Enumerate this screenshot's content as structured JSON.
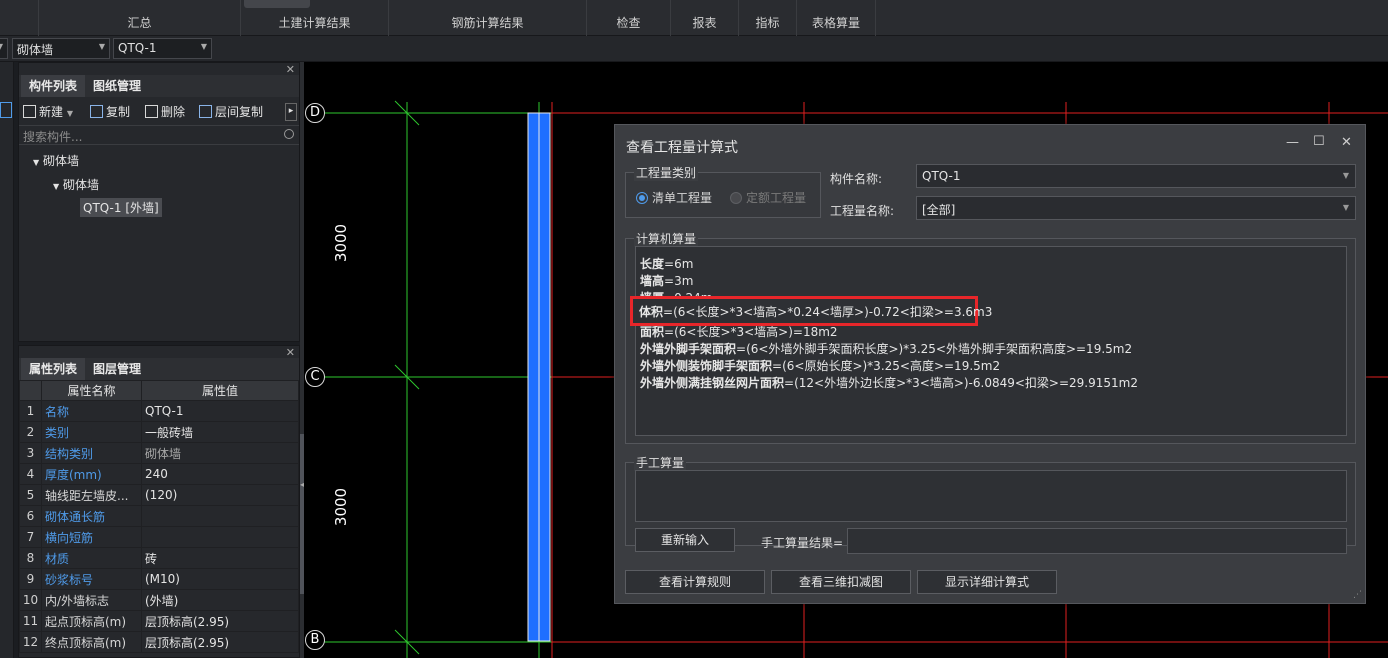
{
  "ribbon": {
    "groups": [
      "汇总",
      "土建计算结果",
      "钢筋计算结果",
      "检查",
      "报表",
      "指标",
      "表格算量"
    ]
  },
  "selectors": {
    "type_value": "砌体墙",
    "name_value": "QTQ-1"
  },
  "component_panel": {
    "tabs": [
      "构件列表",
      "图纸管理"
    ],
    "toolbar": {
      "new": "新建",
      "copy": "复制",
      "delete": "删除",
      "floor_copy": "层间复制"
    },
    "search_placeholder": "搜索构件...",
    "tree": {
      "root": "砌体墙",
      "child": "砌体墙",
      "leaf": "QTQ-1 [外墙]"
    }
  },
  "property_panel": {
    "tabs": [
      "属性列表",
      "图层管理"
    ],
    "columns": [
      "属性名称",
      "属性值"
    ],
    "rows": [
      {
        "num": "1",
        "name": "名称",
        "value": "QTQ-1",
        "blue": true
      },
      {
        "num": "2",
        "name": "类别",
        "value": "一般砖墙",
        "blue": true
      },
      {
        "num": "3",
        "name": "结构类别",
        "value": "砌体墙",
        "blue": true
      },
      {
        "num": "4",
        "name": "厚度(mm)",
        "value": "240",
        "blue": true
      },
      {
        "num": "5",
        "name": "轴线距左墙皮...",
        "value": "(120)",
        "blue": false
      },
      {
        "num": "6",
        "name": "砌体通长筋",
        "value": "",
        "blue": true
      },
      {
        "num": "7",
        "name": "横向短筋",
        "value": "",
        "blue": true
      },
      {
        "num": "8",
        "name": "材质",
        "value": "砖",
        "blue": true
      },
      {
        "num": "9",
        "name": "砂浆标号",
        "value": "(M10)",
        "blue": true
      },
      {
        "num": "10",
        "name": "内/外墙标志",
        "value": "(外墙)",
        "blue": false
      },
      {
        "num": "11",
        "name": "起点顶标高(m)",
        "value": "层顶标高(2.95)",
        "blue": false
      },
      {
        "num": "12",
        "name": "终点顶标高(m)",
        "value": "层顶标高(2.95)",
        "blue": false
      }
    ]
  },
  "canvas": {
    "axis_d": "D",
    "axis_c": "C",
    "axis_b": "B",
    "dim_top": "3000",
    "dim_bottom": "3000"
  },
  "dialog": {
    "title": "查看工程量计算式",
    "qty_type_group": "工程量类别",
    "radio_list": "清单工程量",
    "radio_quota": "定额工程量",
    "component_name_label": "构件名称:",
    "component_name_value": "QTQ-1",
    "qty_name_label": "工程量名称:",
    "qty_name_value": "[全部]",
    "computer_group": "计算机算量",
    "calc_lines": [
      {
        "label": "长度",
        "expr": "=6m"
      },
      {
        "label": "墙高",
        "expr": "=3m"
      },
      {
        "label": "墙厚",
        "expr": "=0.24m"
      },
      {
        "label": "体积",
        "expr": "=(6<长度>*3<墙高>*0.24<墙厚>)-0.72<扣梁>=3.6m3"
      },
      {
        "label": "面积",
        "expr": "=(6<长度>*3<墙高>)=18m2"
      },
      {
        "label": "外墙外脚手架面积",
        "expr": "=(6<外墙外脚手架面积长度>)*3.25<外墙外脚手架面积高度>=19.5m2"
      },
      {
        "label": "外墙外侧装饰脚手架面积",
        "expr": "=(6<原始长度>)*3.25<高度>=19.5m2"
      },
      {
        "label": "外墙外侧满挂钢丝网片面积",
        "expr": "=(12<外墙外边长度>*3<墙高>)-6.0849<扣梁>=29.9151m2"
      }
    ],
    "manual_group": "手工算量",
    "reinput_button": "重新输入",
    "manual_result_label": "手工算量结果=",
    "buttons": {
      "view_rules": "查看计算规则",
      "view_3d": "查看三维扣减图",
      "show_detail": "显示详细计算式"
    }
  }
}
